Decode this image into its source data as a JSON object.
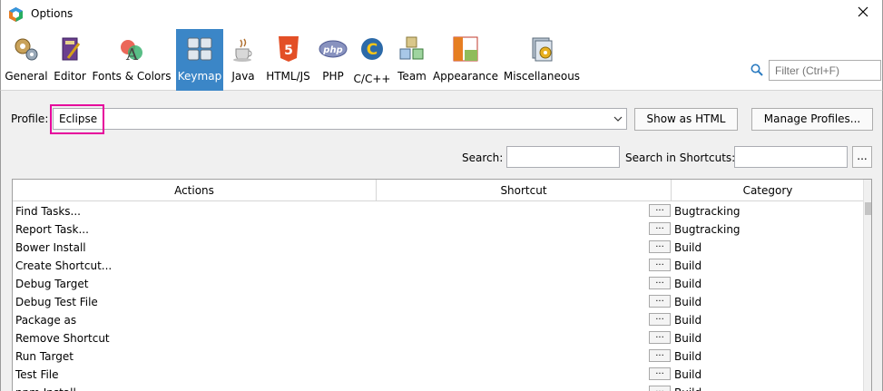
{
  "window": {
    "title": "Options"
  },
  "categories": [
    {
      "label": "General",
      "icon": "gears-icon"
    },
    {
      "label": "Editor",
      "icon": "book-pen-icon"
    },
    {
      "label": "Fonts & Colors",
      "icon": "font-shapes-icon"
    },
    {
      "label": "Keymap",
      "icon": "keyboard-icon",
      "active": true
    },
    {
      "label": "Java",
      "icon": "coffee-cup-icon"
    },
    {
      "label": "HTML/JS",
      "icon": "html5-icon"
    },
    {
      "label": "PHP",
      "icon": "php-icon"
    },
    {
      "label": "C/C++",
      "icon": "c-icon"
    },
    {
      "label": "Team",
      "icon": "cubes-icon"
    },
    {
      "label": "Appearance",
      "icon": "layout-icon"
    },
    {
      "label": "Miscellaneous",
      "icon": "misc-icon"
    }
  ],
  "filter": {
    "placeholder": "Filter (Ctrl+F)"
  },
  "profile": {
    "label": "Profile:",
    "value": "Eclipse"
  },
  "buttons": {
    "show_as_html": "Show as HTML",
    "manage_profiles": "Manage Profiles...",
    "more": "..."
  },
  "search": {
    "label": "Search:",
    "shortcuts_label": "Search in Shortcuts:"
  },
  "table": {
    "columns": [
      "Actions",
      "Shortcut",
      "Category"
    ],
    "shortcut_button": "...",
    "rows": [
      {
        "action": "Find Tasks...",
        "shortcut": "",
        "category": "Bugtracking"
      },
      {
        "action": "Report Task...",
        "shortcut": "",
        "category": "Bugtracking"
      },
      {
        "action": "Bower Install",
        "shortcut": "",
        "category": "Build"
      },
      {
        "action": "Create Shortcut...",
        "shortcut": "",
        "category": "Build"
      },
      {
        "action": "Debug Target",
        "shortcut": "",
        "category": "Build"
      },
      {
        "action": "Debug Test File",
        "shortcut": "",
        "category": "Build"
      },
      {
        "action": "Package as",
        "shortcut": "",
        "category": "Build"
      },
      {
        "action": "Remove Shortcut",
        "shortcut": "",
        "category": "Build"
      },
      {
        "action": "Run Target",
        "shortcut": "",
        "category": "Build"
      },
      {
        "action": "Test File",
        "shortcut": "",
        "category": "Build"
      },
      {
        "action": "npm Install",
        "shortcut": "",
        "category": "Build"
      }
    ]
  },
  "colors": {
    "active_tab": "#3b86c7",
    "highlight_border": "#e6009c"
  }
}
